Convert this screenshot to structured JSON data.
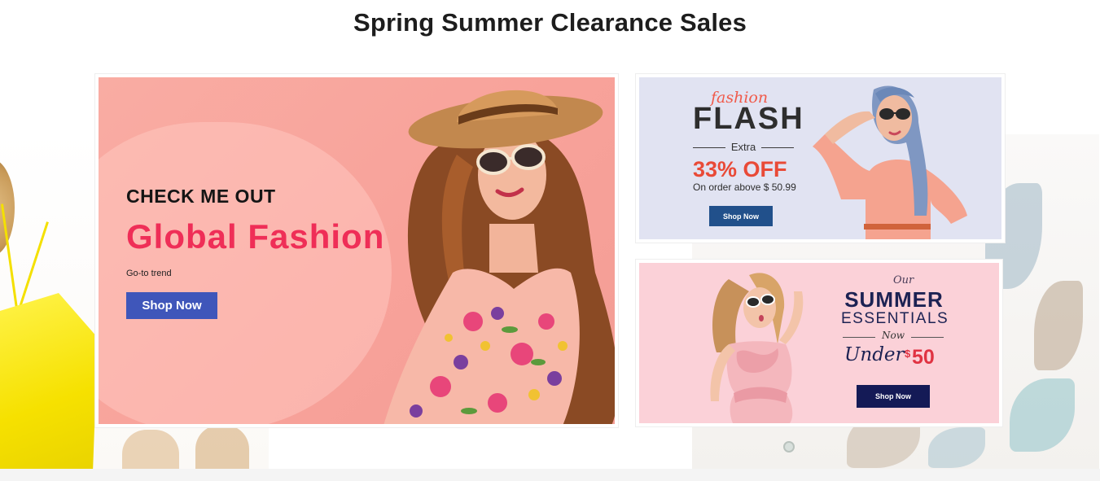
{
  "page": {
    "headline": "Spring Summer Clearance Sales"
  },
  "main_banner": {
    "kicker": "CHECK ME OUT",
    "title": "Global Fashion",
    "subtitle": "Go-to trend",
    "button_label": "Shop Now"
  },
  "flash_banner": {
    "script_word": "fashion",
    "headline": "FLASH",
    "extra": "Extra",
    "offer": "33% OFF",
    "condition": "On order above $ 50.99",
    "button_label": "Shop Now"
  },
  "summer_banner": {
    "our": "Our",
    "summer": "SUMMER",
    "essentials": "ESSENTIALS",
    "now": "Now",
    "under": "Under",
    "currency": "$",
    "price": "50",
    "button_label": "Shop Now"
  },
  "colors": {
    "main_bg": "#f9aca3",
    "main_title": "#ef2e57",
    "main_button": "#3f56ba",
    "flash_bg": "#e1e3f2",
    "flash_offer": "#e94a37",
    "flash_button": "#21508b",
    "summer_bg": "#fbd1d8",
    "summer_text": "#1c2253",
    "summer_price": "#e03342",
    "summer_button": "#141a56"
  }
}
